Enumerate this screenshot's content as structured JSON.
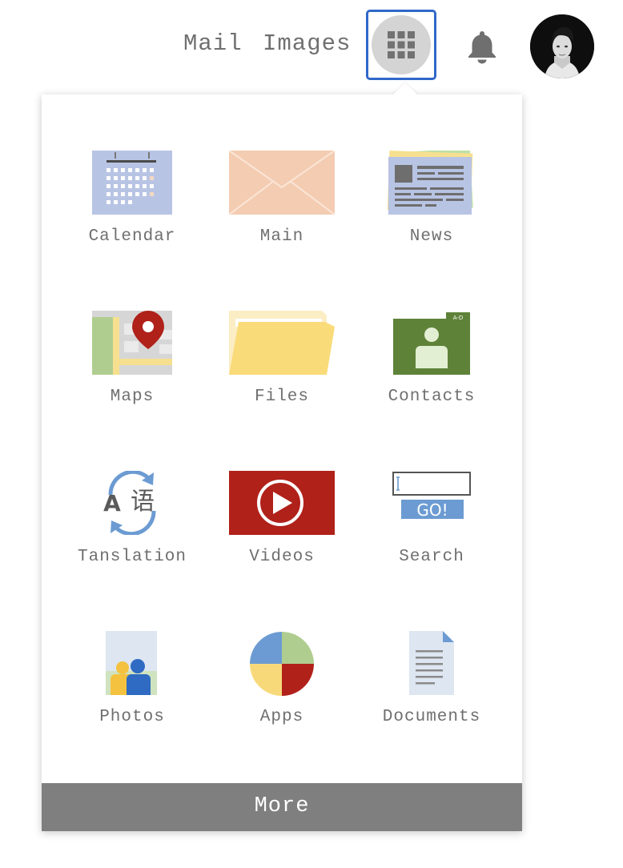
{
  "header": {
    "mail_label": "Mail",
    "images_label": "Images",
    "apps_icon": "grid-icon",
    "notification_icon": "bell-icon",
    "avatar_icon": "user-avatar"
  },
  "apps_menu": {
    "items": [
      {
        "label": "Calendar",
        "icon": "calendar-icon"
      },
      {
        "label": "Main",
        "icon": "mail-envelope-icon"
      },
      {
        "label": "News",
        "icon": "newspaper-icon"
      },
      {
        "label": "Maps",
        "icon": "map-pin-icon"
      },
      {
        "label": "Files",
        "icon": "folder-icon"
      },
      {
        "label": "Contacts",
        "icon": "contacts-icon"
      },
      {
        "label": "Tanslation",
        "icon": "translate-icon"
      },
      {
        "label": "Videos",
        "icon": "play-icon"
      },
      {
        "label": "Search",
        "icon": "search-go-icon"
      },
      {
        "label": "Photos",
        "icon": "photos-icon"
      },
      {
        "label": "Apps",
        "icon": "apps-pie-icon"
      },
      {
        "label": "Documents",
        "icon": "document-icon"
      }
    ],
    "contacts_tab": "A-D",
    "translation_glyphs": {
      "latin": "A",
      "cjk": "语"
    },
    "search_button": "GO!",
    "more_label": "More"
  },
  "colors": {
    "accent_border": "#2f68c9",
    "more_bar": "#7f7f7f",
    "label_text": "#6f6f6f"
  }
}
